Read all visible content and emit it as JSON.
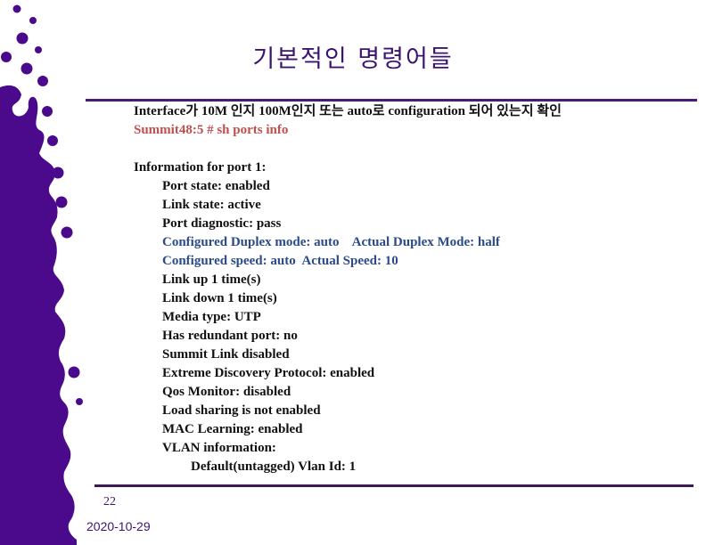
{
  "slide": {
    "title": "기본적인 명령어들",
    "intro_line": "Interface가 10M 인지 100M인지 또는 auto로 configuration 되어 있는지 확인",
    "command": "Summit48:5 # sh ports info",
    "info_header": "Information for port 1:",
    "details": [
      {
        "text": "Port state: enabled",
        "style": "normal",
        "indent": 1
      },
      {
        "text": "Link state: active",
        "style": "normal",
        "indent": 1
      },
      {
        "text": "Port diagnostic: pass",
        "style": "normal",
        "indent": 1
      },
      {
        "text": "Configured Duplex mode: auto    Actual Duplex Mode: half",
        "style": "blue",
        "indent": 1
      },
      {
        "text": "Configured speed: auto  Actual Speed: 10",
        "style": "blue",
        "indent": 1
      },
      {
        "text": "Link up 1 time(s)",
        "style": "normal",
        "indent": 1
      },
      {
        "text": "Link down 1 time(s)",
        "style": "normal",
        "indent": 1
      },
      {
        "text": "Media type: UTP",
        "style": "normal",
        "indent": 1
      },
      {
        "text": "Has redundant port: no",
        "style": "normal",
        "indent": 1
      },
      {
        "text": "Summit Link disabled",
        "style": "normal",
        "indent": 1
      },
      {
        "text": "Extreme Discovery Protocol: enabled",
        "style": "normal",
        "indent": 1
      },
      {
        "text": "Qos Monitor: disabled",
        "style": "normal",
        "indent": 1
      },
      {
        "text": "Load sharing is not enabled",
        "style": "normal",
        "indent": 1
      },
      {
        "text": "MAC Learning: enabled",
        "style": "normal",
        "indent": 1
      },
      {
        "text": "VLAN information:",
        "style": "normal",
        "indent": 1
      },
      {
        "text": "Default(untagged) Vlan Id: 1",
        "style": "normal",
        "indent": 2
      }
    ],
    "page_number": "22",
    "date": "2020-10-29"
  },
  "colors": {
    "accent": "#4b0a8c",
    "title": "#3b1470",
    "command": "#c0504d",
    "highlight": "#2a4a8a"
  }
}
